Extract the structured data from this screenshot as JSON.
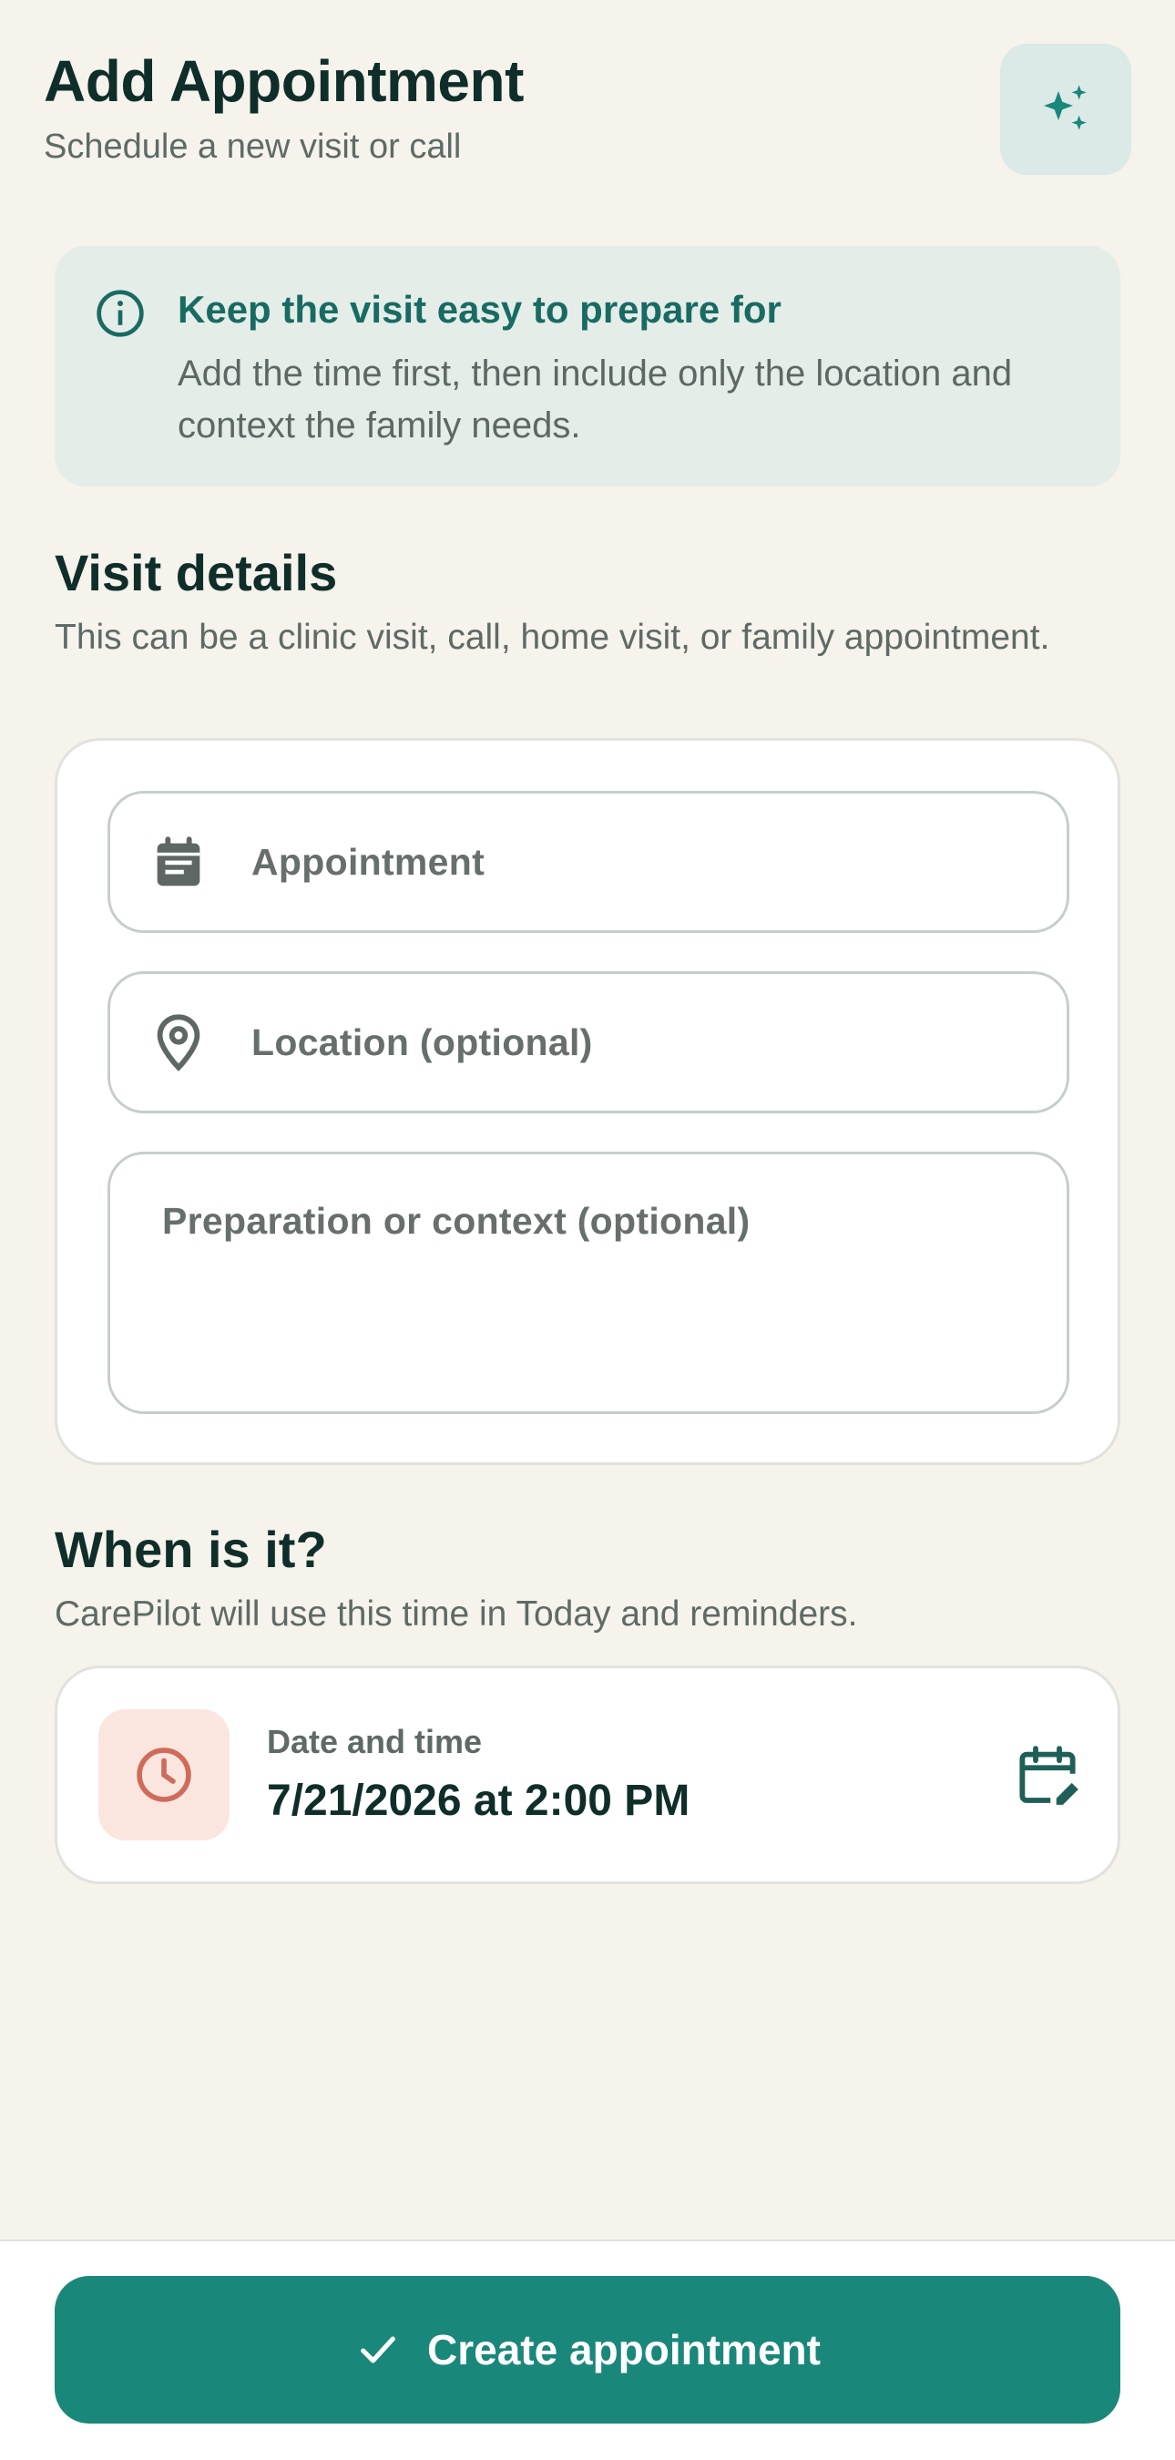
{
  "header": {
    "title": "Add Appointment",
    "subtitle": "Schedule a new visit or call",
    "magic_icon": "sparkles-icon"
  },
  "tip": {
    "icon": "info-icon",
    "title": "Keep the visit easy to prepare for",
    "body": "Add the time first, then include only the location and context the family needs."
  },
  "visit_details": {
    "title": "Visit details",
    "subtitle": "This can be a clinic visit, call, home visit, or family appointment.",
    "fields": {
      "appointment_placeholder": "Appointment",
      "location_placeholder": "Location (optional)",
      "context_placeholder": "Preparation or context (optional)"
    }
  },
  "when": {
    "title": "When is it?",
    "subtitle": "CarePilot will use this time in Today and reminders.",
    "label": "Date and time",
    "value": "7/21/2026 at 2:00 PM"
  },
  "footer": {
    "create_label": "Create appointment"
  },
  "colors": {
    "background": "#f6f2ec",
    "accent": "#1a877b",
    "tip_background": "#e5ede8",
    "clock_background": "#fbe6df",
    "clock_color": "#cf6b5b"
  }
}
